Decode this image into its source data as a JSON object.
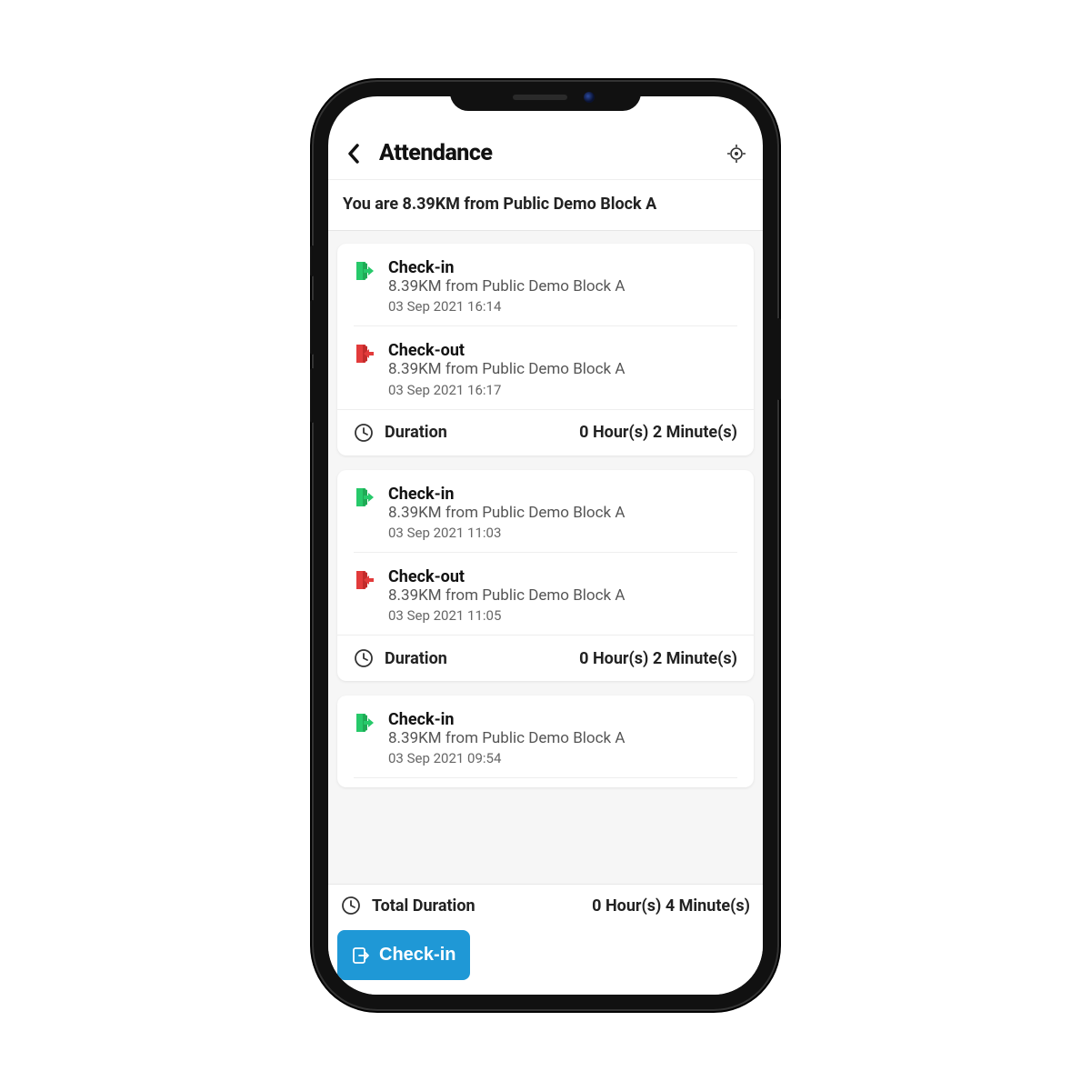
{
  "header": {
    "title": "Attendance"
  },
  "subheader": "You are 8.39KM from Public Demo Block A",
  "sessions": [
    {
      "checkin": {
        "title": "Check-in",
        "sub": "8.39KM from Public Demo Block A",
        "time": "03 Sep 2021 16:14"
      },
      "checkout": {
        "title": "Check-out",
        "sub": "8.39KM from Public Demo Block A",
        "time": "03 Sep 2021 16:17"
      },
      "duration_label": "Duration",
      "duration_value": "0 Hour(s) 2 Minute(s)"
    },
    {
      "checkin": {
        "title": "Check-in",
        "sub": "8.39KM from Public Demo Block A",
        "time": "03 Sep 2021 11:03"
      },
      "checkout": {
        "title": "Check-out",
        "sub": "8.39KM from Public Demo Block A",
        "time": "03 Sep 2021 11:05"
      },
      "duration_label": "Duration",
      "duration_value": "0 Hour(s) 2 Minute(s)"
    },
    {
      "checkin": {
        "title": "Check-in",
        "sub": "8.39KM from Public Demo Block A",
        "time": "03 Sep 2021 09:54"
      }
    }
  ],
  "total": {
    "label": "Total Duration",
    "value": "0 Hour(s) 4 Minute(s)"
  },
  "checkin_button": "Check-in"
}
